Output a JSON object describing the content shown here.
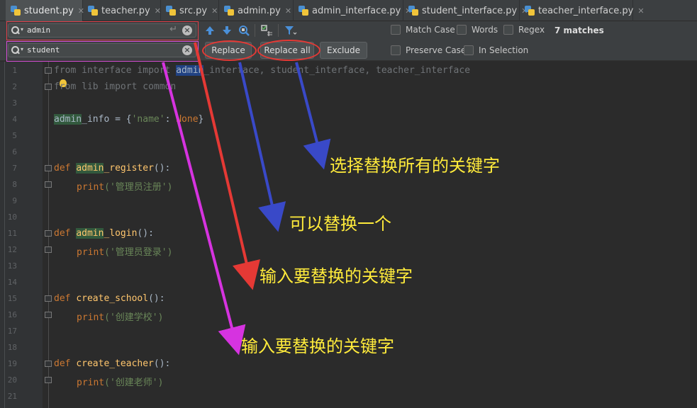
{
  "tabs": [
    {
      "label": "student.py"
    },
    {
      "label": "teacher.py"
    },
    {
      "label": "src.py"
    },
    {
      "label": "admin.py"
    },
    {
      "label": "admin_interface.py"
    },
    {
      "label": "student_interface.py"
    },
    {
      "label": "teacher_interface.py"
    }
  ],
  "find": {
    "search_value": "admin",
    "replace_value": "student",
    "buttons": {
      "replace": "Replace",
      "replace_all": "Replace all",
      "exclude": "Exclude"
    },
    "options": {
      "match_case": "Match Case",
      "words": "Words",
      "regex": "Regex",
      "preserve_case": "Preserve Case",
      "in_selection": "In Selection"
    },
    "matches": "7 matches"
  },
  "editor": {
    "line_numbers": [
      "1",
      "2",
      "3",
      "4",
      "5",
      "6",
      "7",
      "8",
      "9",
      "10",
      "11",
      "12",
      "13",
      "14",
      "15",
      "16",
      "17",
      "18",
      "19",
      "20",
      "21"
    ],
    "code": {
      "l1_from": "from",
      "l1_interface": "interface",
      "l1_import": "import",
      "l1_admin": "admin",
      "l1_rest1": "_interface, student_interface, teacher_interface",
      "l2_from": "from",
      "l2_lib": "lib",
      "l2_import": "import",
      "l2_common": "common",
      "l4_admin": "admin",
      "l4_rest": "_info = {",
      "l4_key": "'name'",
      "l4_colon": ": ",
      "l4_none": "None",
      "l4_close": "}",
      "def": "def",
      "l7_admin": "admin",
      "l7_rest": "_register",
      "paren": "():",
      "print": "print",
      "l8_str": "('管理员注册')",
      "l11_admin": "admin",
      "l11_rest": "_login",
      "l12_str": "('管理员登录')",
      "l15_name": "create_school",
      "l16_str": "('创建学校')",
      "l19_name": "create_teacher",
      "l20_str": "('创建老师')"
    }
  },
  "annotations": {
    "replace_all_note": "选择替换所有的关键字",
    "replace_one_note": "可以替换一个",
    "search_note": "输入要替换的关键字",
    "replace_field_note": "输入要替换的关键字"
  },
  "colors": {
    "arrow_blue": "#3949c8",
    "arrow_red": "#e53935",
    "arrow_magenta": "#d633e0",
    "note_text": "#ffeb3b"
  }
}
